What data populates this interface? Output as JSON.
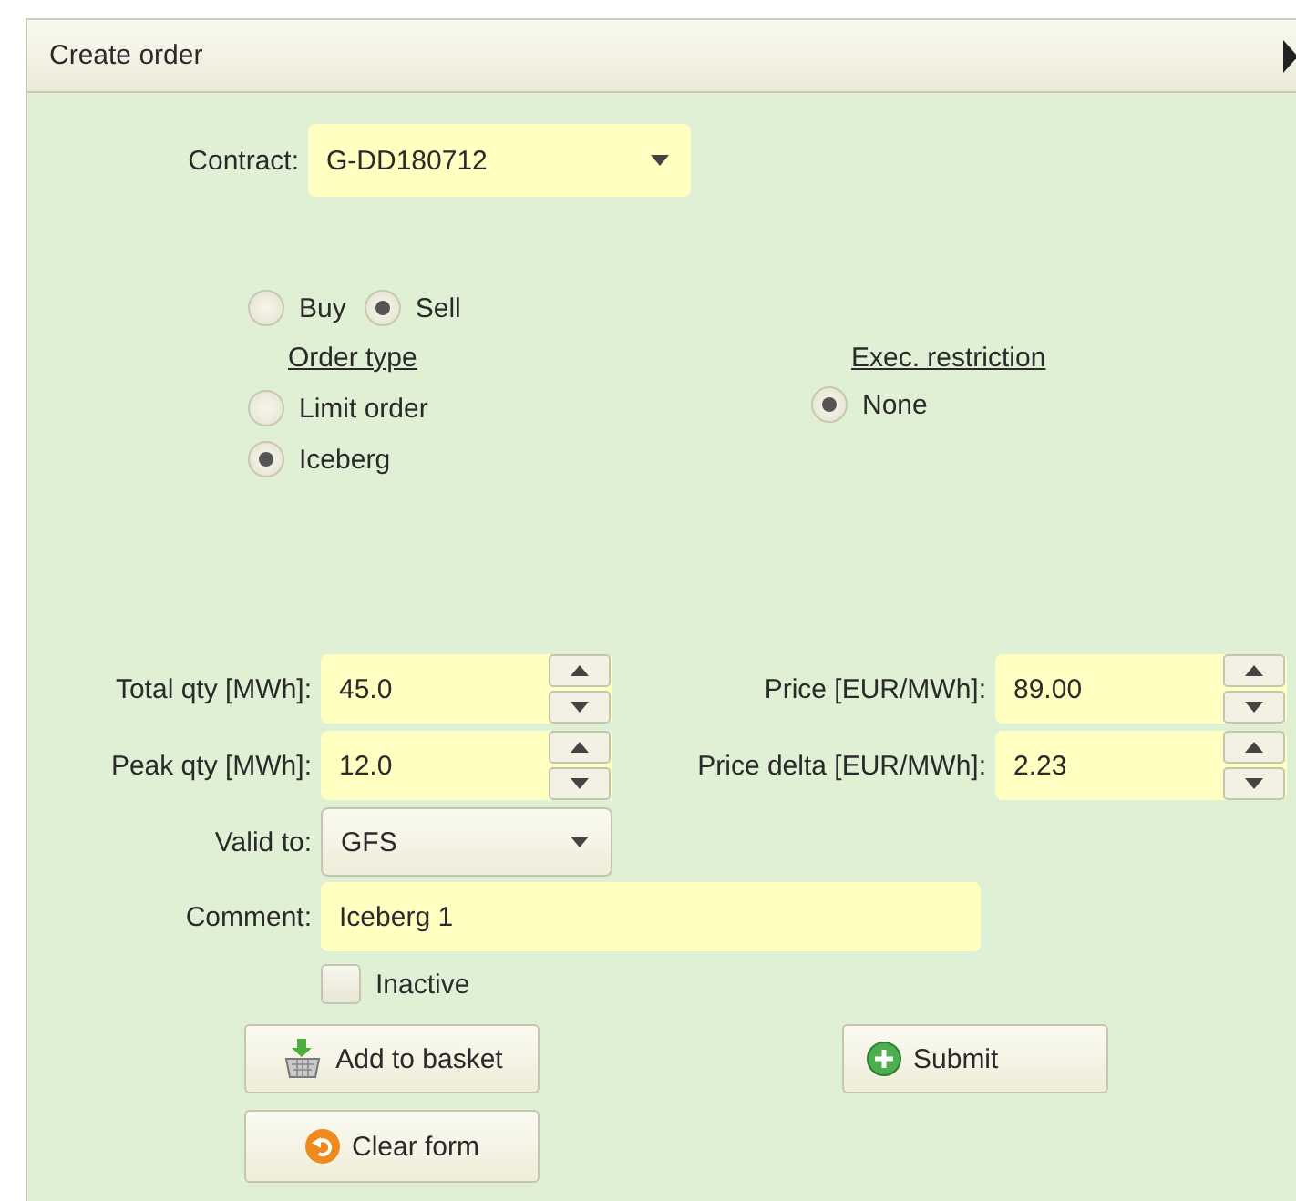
{
  "panel": {
    "title": "Create order"
  },
  "contract": {
    "label": "Contract:",
    "value": "G-DD180712"
  },
  "side": [
    {
      "label": "Buy",
      "selected": false
    },
    {
      "label": "Sell",
      "selected": true
    }
  ],
  "order_type": {
    "heading": "Order type",
    "options": [
      {
        "label": "Limit order",
        "selected": false
      },
      {
        "label": "Iceberg",
        "selected": true
      }
    ]
  },
  "exec_restriction": {
    "heading": "Exec. restriction",
    "options": [
      {
        "label": "None",
        "selected": true
      }
    ]
  },
  "spin_rows": [
    {
      "left": {
        "label": "Total qty [MWh]:",
        "value": "45.0"
      },
      "right": {
        "label": "Price [EUR/MWh]:",
        "value": "89.00"
      }
    },
    {
      "left": {
        "label": "Peak qty [MWh]:",
        "value": "12.0"
      },
      "right": {
        "label": "Price delta [EUR/MWh]:",
        "value": "2.23"
      }
    }
  ],
  "valid_to": {
    "label": "Valid to:",
    "value": "GFS"
  },
  "comment": {
    "label": "Comment:",
    "value": "Iceberg 1"
  },
  "inactive": {
    "label": "Inactive",
    "checked": false
  },
  "buttons": [
    {
      "label": "Add to basket",
      "kind": "basket"
    },
    {
      "label": "Submit",
      "kind": "submit"
    },
    {
      "label": "Clear form",
      "kind": "clear"
    }
  ]
}
